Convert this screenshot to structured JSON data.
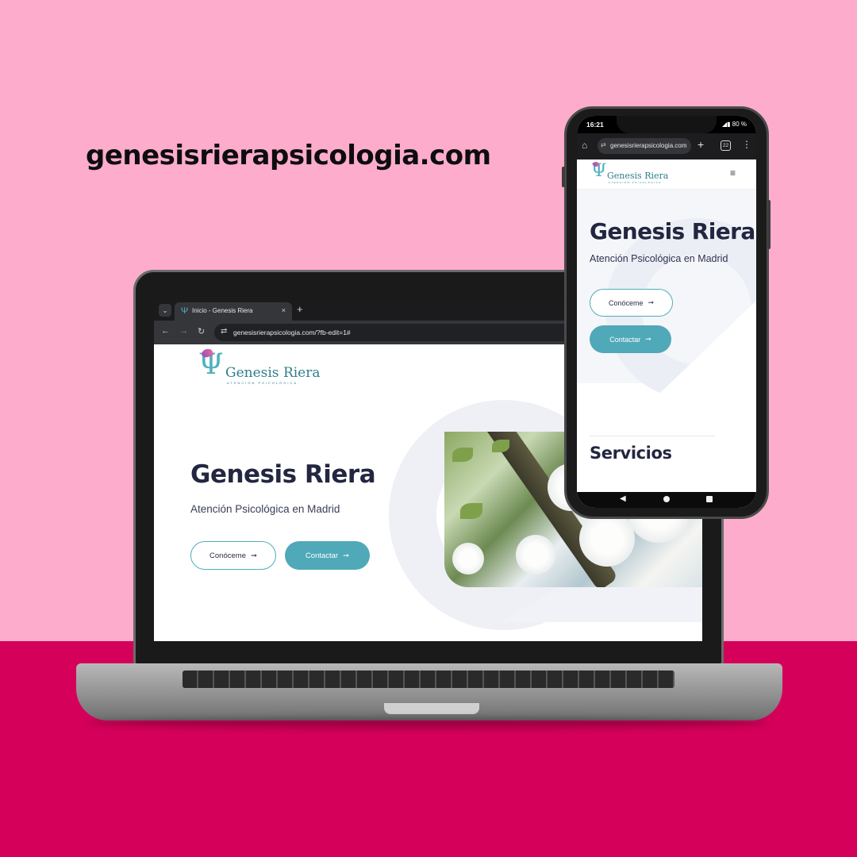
{
  "headline": {
    "domain": "genesisrierapsicologia.com"
  },
  "colors": {
    "pink_bg": "#fdaccb",
    "magenta_bg": "#d4005a",
    "accent_teal": "#4fa9b8",
    "title_navy": "#232640"
  },
  "laptop": {
    "browser": {
      "tab_title": "Inicio - Genesis Riera",
      "tab_close": "×",
      "new_tab": "+",
      "url": "genesisrierapsicologia.com/?fb-edit=1#",
      "icons": [
        "chevron-down-icon",
        "back-arrow-icon",
        "forward-arrow-icon",
        "reload-icon",
        "site-settings-icon"
      ]
    },
    "site": {
      "logo_name": "Genesis Riera",
      "logo_sub": "ATENCIÓN PSICOLÓGICA",
      "hero_title": "Genesis Riera",
      "hero_subtitle": "Atención Psicológica en Madrid",
      "btn_about": "Conóceme",
      "btn_contact": "Contactar",
      "arrow": "➞"
    }
  },
  "phone": {
    "status": {
      "time": "16:21",
      "battery": "◢▮ 80 %"
    },
    "browser": {
      "url": "genesisrierapsicologia.com",
      "tab_count": "22",
      "plus": "+",
      "menu": "⋮"
    },
    "site": {
      "logo_name": "Genesis Riera",
      "logo_sub": "ATENCIÓN PSICOLÓGICA",
      "menu_icon": "≡",
      "hero_title": "Genesis Riera",
      "hero_subtitle": "Atención Psicológica en Madrid",
      "btn_about": "Conóceme",
      "btn_contact": "Contactar",
      "arrow": "➞",
      "section_title": "Servicios"
    },
    "nav": {
      "back": "◀"
    }
  }
}
